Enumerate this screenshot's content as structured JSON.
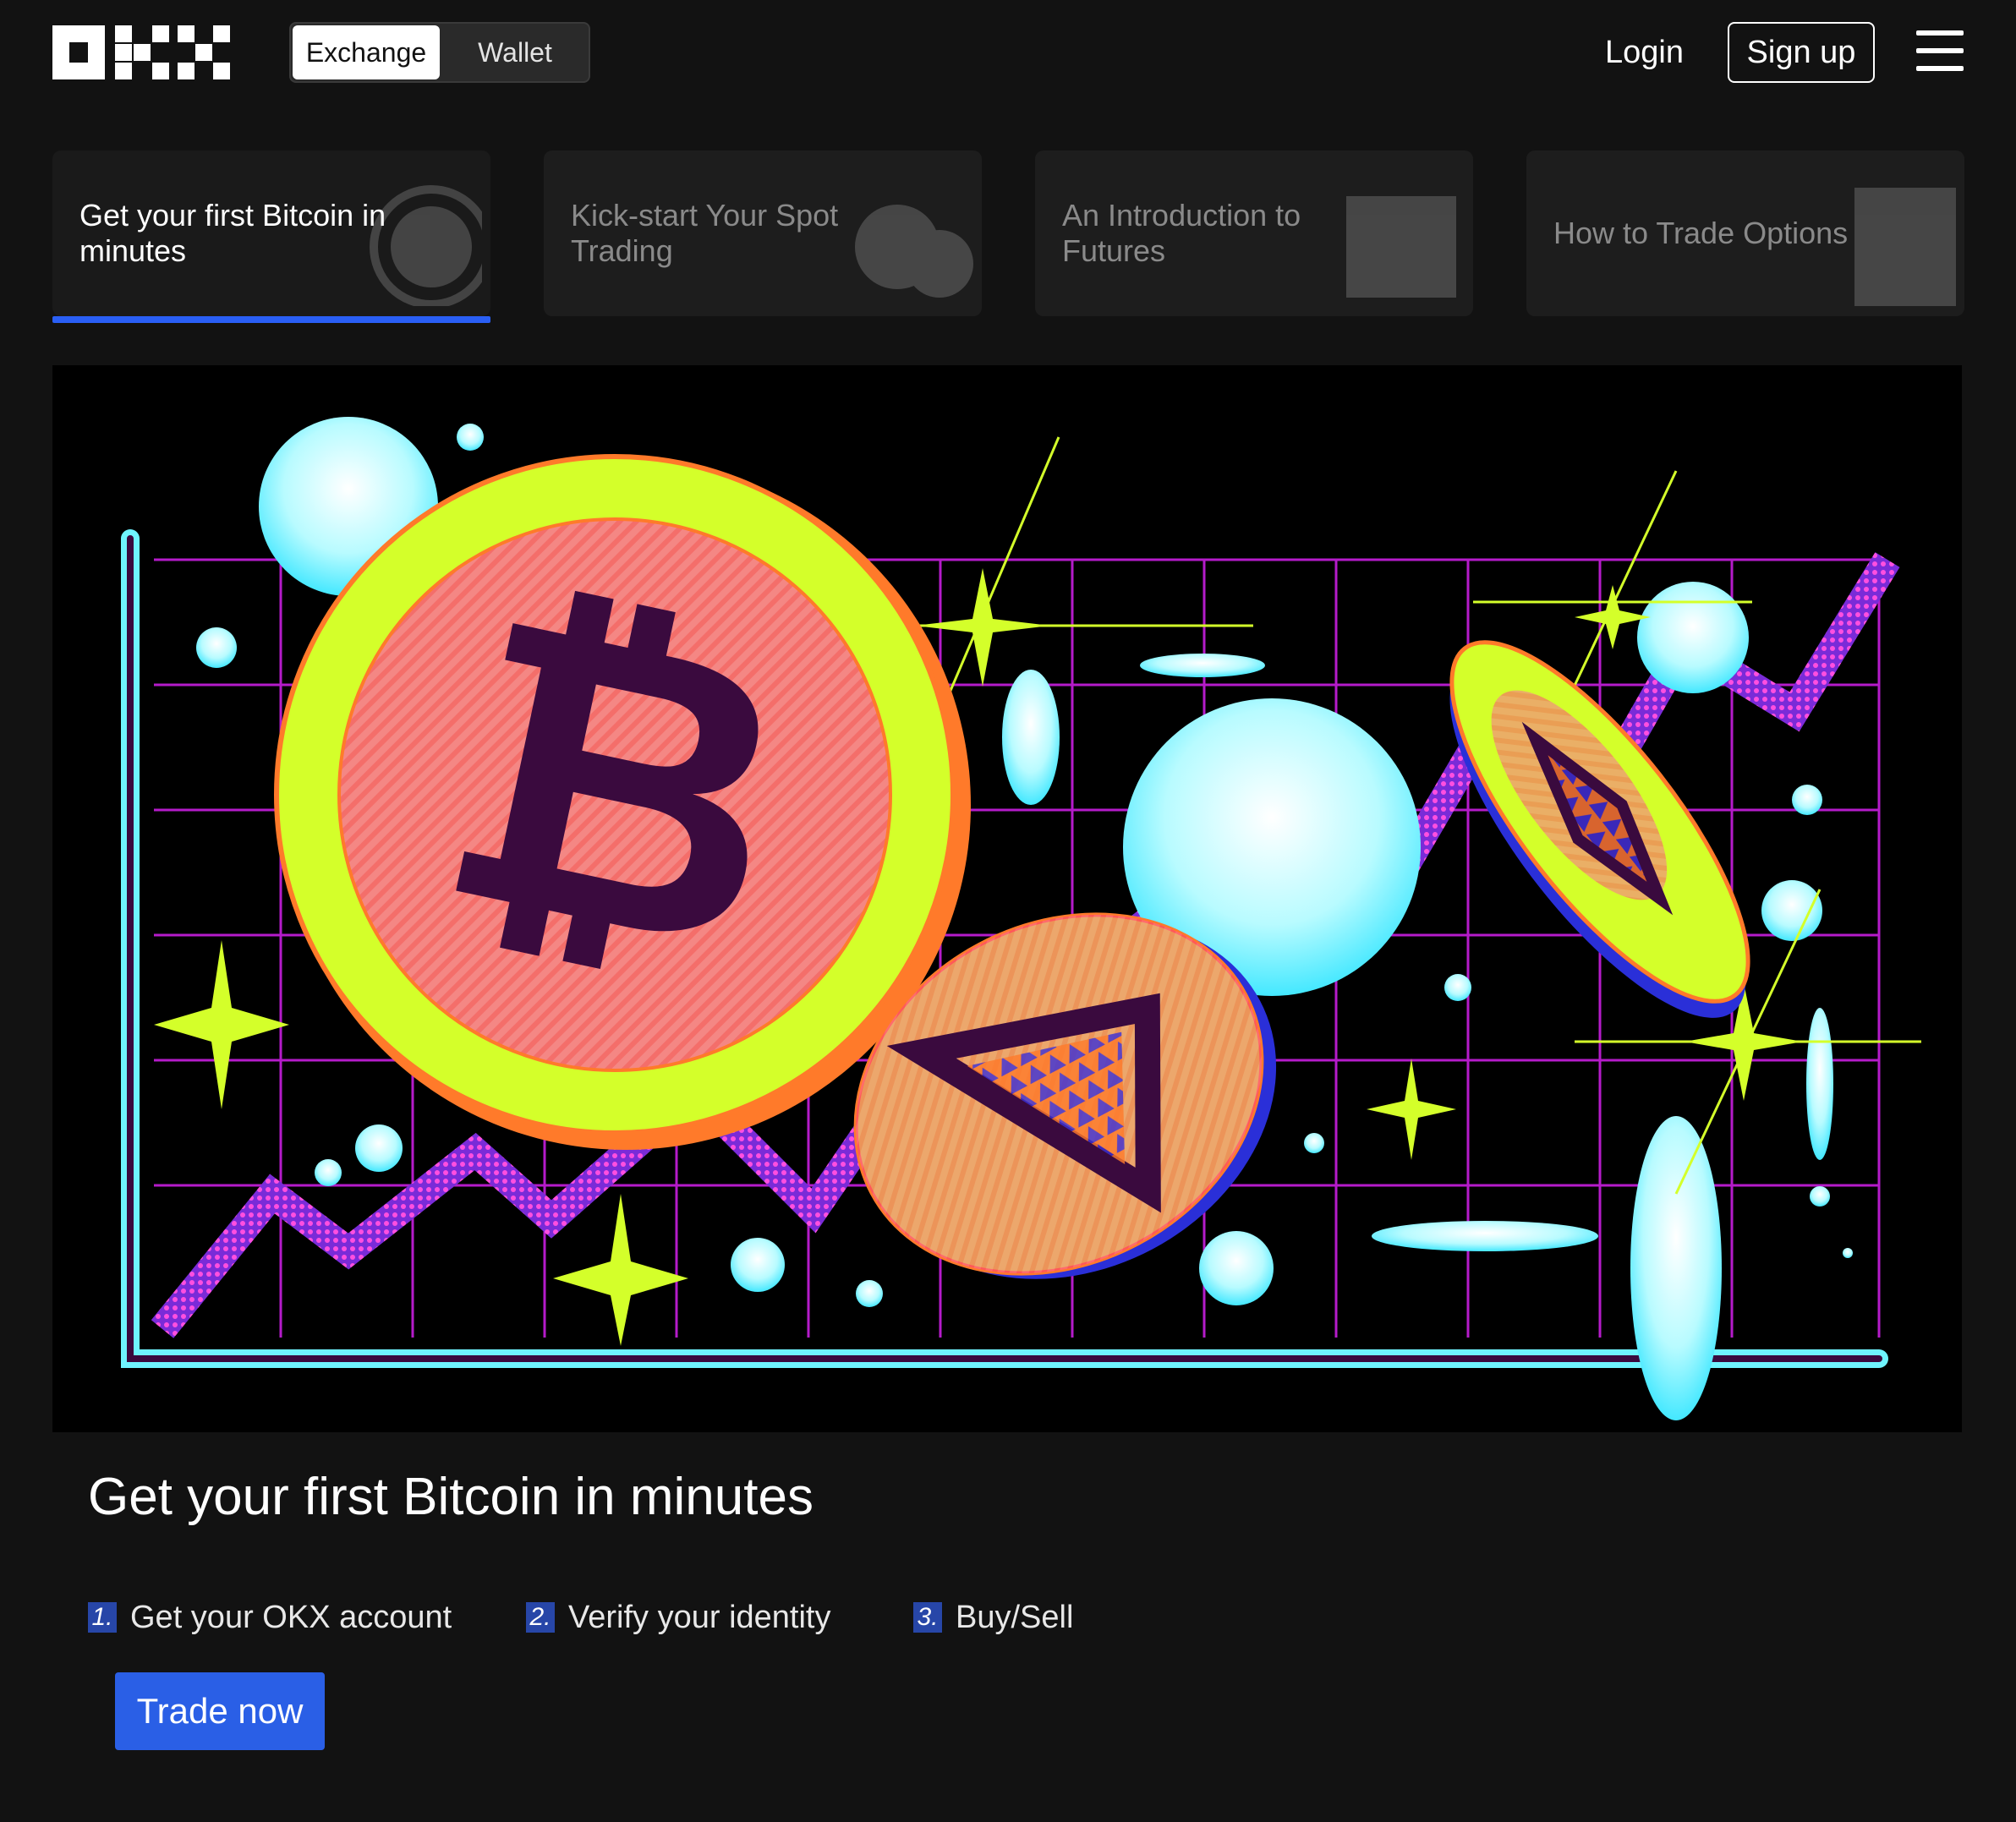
{
  "header": {
    "logo_text": "OKX",
    "toggle": [
      "Exchange",
      "Wallet"
    ],
    "active_toggle": "Exchange",
    "login_label": "Login",
    "signup_label": "Sign up",
    "menu_icon": "hamburger-menu-icon"
  },
  "tabs": [
    {
      "label": "Get your first Bitcoin in minutes",
      "active": true,
      "icon": "bitcoin-coin-icon"
    },
    {
      "label": "Kick-start Your Spot Trading",
      "active": false,
      "icon": "coins-icon"
    },
    {
      "label": "An Introduction to Futures",
      "active": false,
      "icon": "chart-window-icon"
    },
    {
      "label": "How to Trade Options",
      "active": false,
      "icon": "document-icon"
    }
  ],
  "hero": {
    "illustration": "crypto-coins-chart-illustration",
    "colors": {
      "neon_green": "#d4ff2a",
      "pink": "#ff5fa2",
      "cyan": "#6ff4ff",
      "magenta": "#d230d8",
      "purple": "#3a0a3e"
    }
  },
  "main": {
    "headline": "Get your first Bitcoin in minutes",
    "steps": [
      {
        "num": "1.",
        "text": "Get your OKX account"
      },
      {
        "num": "2.",
        "text": "Verify your identity"
      },
      {
        "num": "3.",
        "text": "Buy/Sell"
      }
    ],
    "cta_label": "Trade now"
  },
  "colors": {
    "background": "#121212",
    "accent": "#2a5fe6"
  }
}
